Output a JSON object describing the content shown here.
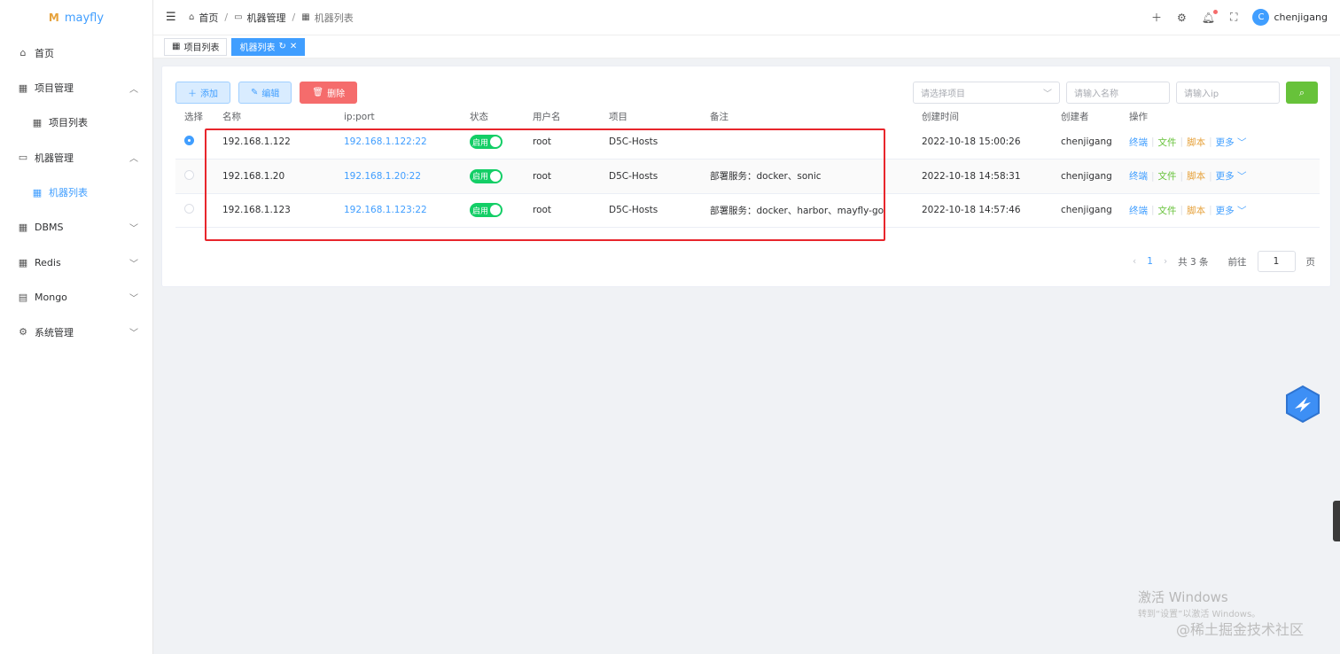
{
  "app": {
    "logo_text": "mayfly"
  },
  "sidebar": {
    "items": [
      {
        "label": "首页"
      },
      {
        "label": "项目管理"
      },
      {
        "label": "项目列表"
      },
      {
        "label": "机器管理"
      },
      {
        "label": "机器列表"
      },
      {
        "label": "DBMS"
      },
      {
        "label": "Redis"
      },
      {
        "label": "Mongo"
      },
      {
        "label": "系统管理"
      }
    ]
  },
  "header": {
    "breadcrumb": [
      "首页",
      "机器管理",
      "机器列表"
    ],
    "username": "chenjigang",
    "avatar_letter": "C"
  },
  "tabs": [
    {
      "label": "项目列表"
    },
    {
      "label": "机器列表"
    }
  ],
  "toolbar": {
    "add_label": "添加",
    "edit_label": "编辑",
    "delete_label": "删除",
    "project_select_placeholder": "请选择项目",
    "name_placeholder": "请输入名称",
    "ip_placeholder": "请输入ip"
  },
  "table": {
    "columns": [
      "选择",
      "名称",
      "ip:port",
      "状态",
      "用户名",
      "项目",
      "备注",
      "创建时间",
      "创建者",
      "操作"
    ],
    "rows": [
      {
        "name": "192.168.1.122",
        "ipport": "192.168.1.122:22",
        "status": "启用",
        "username": "root",
        "project": "D5C-Hosts",
        "remark": "",
        "created": "2022-10-18 15:00:26",
        "creator": "chenjigang",
        "selected": true
      },
      {
        "name": "192.168.1.20",
        "ipport": "192.168.1.20:22",
        "status": "启用",
        "username": "root",
        "project": "D5C-Hosts",
        "remark": "部署服务：docker、sonic",
        "created": "2022-10-18 14:58:31",
        "creator": "chenjigang",
        "selected": false
      },
      {
        "name": "192.168.1.123",
        "ipport": "192.168.1.123:22",
        "status": "启用",
        "username": "root",
        "project": "D5C-Hosts",
        "remark": "部署服务：docker、harbor、mayfly-go",
        "created": "2022-10-18 14:57:46",
        "creator": "chenjigang",
        "selected": false
      }
    ],
    "ops": {
      "terminal": "终端",
      "file": "文件",
      "script": "脚本",
      "more": "更多"
    }
  },
  "pagination": {
    "current": "1",
    "total_text": "共 3 条",
    "goto_label": "前往",
    "goto_value": "1",
    "page_suffix": "页"
  },
  "watermark": {
    "activate_title": "激活 Windows",
    "activate_sub": "转到“设置”以激活 Windows。",
    "site": "@稀土掘金技术社区"
  },
  "colors": {
    "primary": "#409eff",
    "success": "#13ce66",
    "danger": "#f56c6c",
    "warning": "#e6a23c",
    "highlight_box": "#e8262c"
  }
}
